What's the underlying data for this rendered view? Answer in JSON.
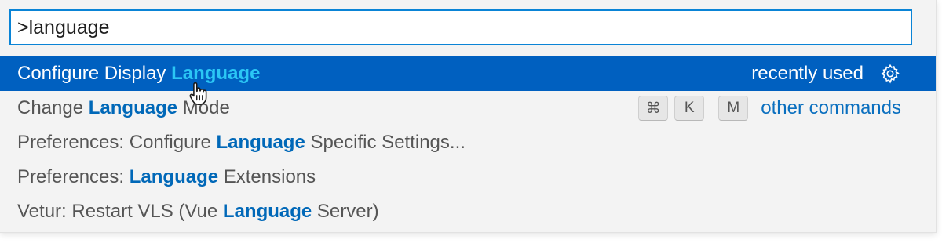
{
  "search": {
    "value": ">language"
  },
  "results": [
    {
      "prefix": "Configure Display ",
      "match": "Language",
      "suffix": "",
      "selected": true,
      "right_label": "recently used",
      "icon": "gear-icon"
    },
    {
      "prefix": "Change ",
      "match": "Language",
      "suffix": " Mode",
      "selected": false,
      "keybinding": [
        "⌘",
        "K",
        "M"
      ],
      "right_label": "other commands"
    },
    {
      "prefix": "Preferences: Configure ",
      "match": "Language",
      "suffix": " Specific Settings...",
      "selected": false
    },
    {
      "prefix": "Preferences: ",
      "match": "Language",
      "suffix": " Extensions",
      "selected": false
    },
    {
      "prefix": "Vetur: Restart VLS (Vue ",
      "match": "Language",
      "suffix": " Server)",
      "selected": false
    }
  ],
  "colors": {
    "selected_bg": "#0060c0",
    "match_highlight": "#0068b8",
    "match_highlight_selected": "#2bc7f5",
    "input_border": "#0a84d6"
  },
  "mouse_pointer": "hand-pointer-icon"
}
